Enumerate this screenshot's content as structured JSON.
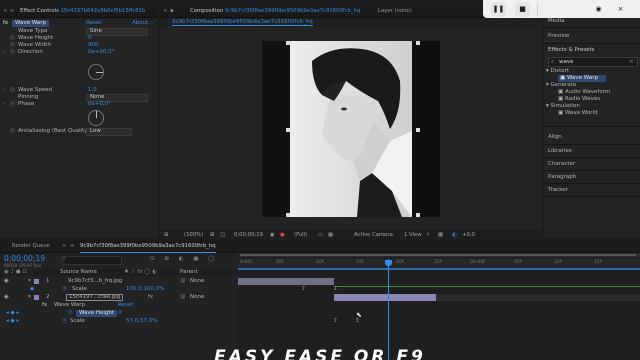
{
  "effect_controls": {
    "tab_prefix": "Effect Controls",
    "tab_file": "15c4197b642e8b0cf5b15ffc81b",
    "effect_name": "Wave Warp",
    "reset_label": "Reset",
    "about_label": "About...",
    "props": [
      {
        "name": "Wave Type",
        "value": "Sine"
      },
      {
        "name": "Wave Height",
        "value": "0"
      },
      {
        "name": "Wave Width",
        "value": "900"
      },
      {
        "name": "Direction",
        "value": "0x+90,0°"
      },
      {
        "name": "Wave Speed",
        "value": "1,0"
      },
      {
        "name": "Pinning",
        "value": "None"
      },
      {
        "name": "Phase",
        "value": "0x+0,0°"
      },
      {
        "name": "Antialiasing (Best Quality)",
        "value": "Low"
      }
    ]
  },
  "composition": {
    "tab_prefix": "Composition",
    "tab_name": "9c9b7cf30f8ae399f0be9509b9a3ae7c91600fcb_hq",
    "layer_tab": "Layer (none)",
    "sub_tab": "9c9b7cf30f8ae399f0be9509b9a3ae7c91600fcb_hq"
  },
  "viewer_bar": {
    "zoom": "(100%)",
    "timecode": "0;00;00;19",
    "resolution": "(Full)",
    "camera": "Active Camera",
    "view": "1 View",
    "exposure": "+0,0"
  },
  "right_panel": {
    "header_items": [
      "Media",
      "Preview"
    ],
    "effects_title": "Effects & Presets",
    "search_value": "wave",
    "tree": [
      {
        "label": "Distort",
        "depth": 0
      },
      {
        "label": "Wave Warp",
        "depth": 1,
        "selected": true
      },
      {
        "label": "Generate",
        "depth": 0
      },
      {
        "label": "Audio Waveform",
        "depth": 1
      },
      {
        "label": "Radio Waves",
        "depth": 1
      },
      {
        "label": "Simulation",
        "depth": 0
      },
      {
        "label": "Wave World",
        "depth": 1
      }
    ],
    "panels": [
      "Align",
      "Libraries",
      "Character",
      "Paragraph",
      "Tracker"
    ]
  },
  "timeline": {
    "render_queue_tab": "Render Queue",
    "comp_tab": "9c9b7cf30f8ae399f0be9509b9a3ae7c91600fcb_hq",
    "timecode": "0;00;00;19",
    "fps": "00019 (29.97 fps)",
    "col_source": "Source Name",
    "col_parent": "Parent",
    "layers": [
      {
        "num": "1",
        "name": "9c9b7cf3...b_hq.jpg",
        "parent": "None",
        "prop_name": "Scale",
        "prop_value": "100,0,100,0%"
      },
      {
        "num": "2",
        "name": "15c4197...cfae.jpg",
        "parent": "None"
      }
    ],
    "effect_row": "Wave Warp",
    "effect_reset": "Reset",
    "wave_height_label": "Wave Height",
    "wave_height_value": "0",
    "scale2_label": "Scale",
    "scale2_value": "57,0,57,0%",
    "ruler_labels": [
      "0:00f",
      "05f",
      "10f",
      "15f",
      "20f",
      "25f",
      "01:00f",
      "05f",
      "10f",
      "15f"
    ]
  },
  "recorder": {
    "buttons": [
      "pause",
      "stop",
      "webcam",
      "close"
    ]
  },
  "caption": "EASY EASE OR F9",
  "colors": {
    "accent_blue": "#2f8ee8",
    "selection": "#2e4a70",
    "layer1_bar": "#6f6f8a",
    "layer2_bar": "#8a86b4",
    "work_area": "#2f8ee8"
  }
}
